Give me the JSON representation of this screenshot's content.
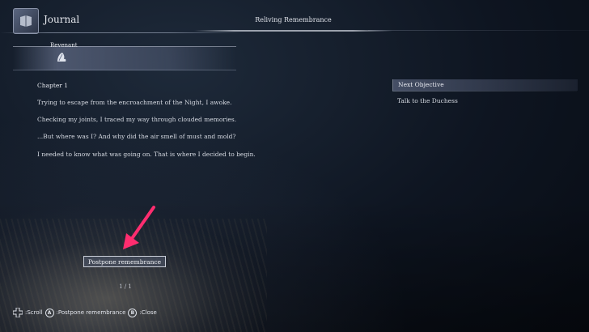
{
  "header": {
    "journal_label": "Journal",
    "section_title": "Reliving Remembrance"
  },
  "character": {
    "name": "Revenant"
  },
  "entry": {
    "chapter": "Chapter 1",
    "paragraphs": [
      "Trying to escape from the encroachment of the Night, I awoke.",
      "Checking my joints, I traced my way through clouded memories.",
      "...But where was I? And why did the air smell of must and mold?",
      "I needed to know what was going on. That is where I decided to begin."
    ]
  },
  "objective": {
    "header": "Next Objective",
    "items": [
      "Talk to the Duchess"
    ]
  },
  "actions": {
    "postpone_label": "Postpone remembrance",
    "pager": "1 / 1"
  },
  "footer": {
    "scroll_label": ":Scroll",
    "a_button": "A",
    "postpone_label": ":Postpone remembrance",
    "b_button": "B",
    "close_label": ":Close"
  },
  "colors": {
    "annotation_arrow": "#ff2d6f",
    "accent_text": "#e8eaf0"
  }
}
